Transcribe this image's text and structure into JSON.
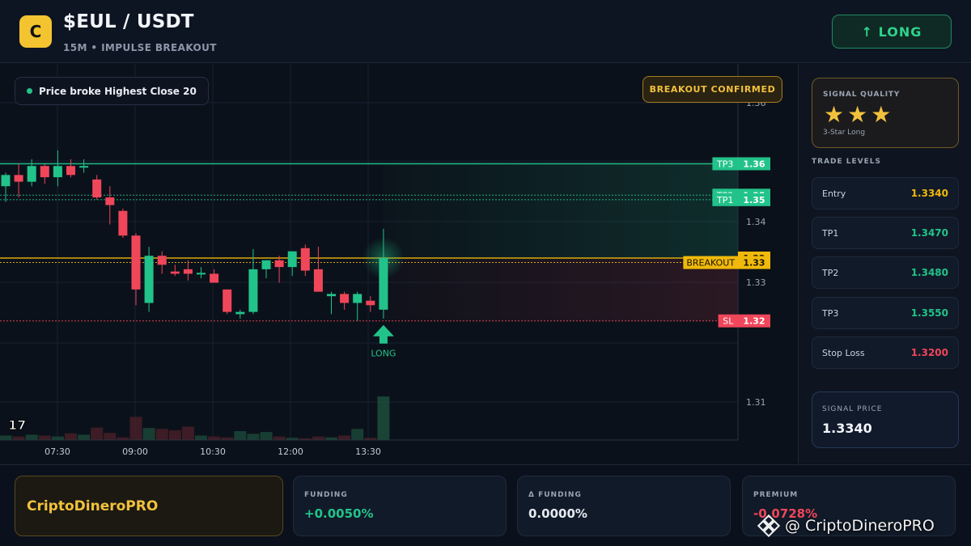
{
  "header": {
    "logo_letter": "C",
    "pair": "$EUL / USDT",
    "subtitle": "15M • IMPULSE BREAKOUT",
    "direction_button": "↑ LONG"
  },
  "chart": {
    "info_pill": "Price broke Highest Close 20",
    "badge": "BREAKOUT CONFIRMED",
    "tv_logo": "17",
    "signal_marker_label": "LONG",
    "price_axis": [
      "1.36",
      "1.35",
      "1.34",
      "1.33",
      "1.31"
    ],
    "time_axis": [
      "07:30",
      "09:00",
      "10:30",
      "12:00",
      "13:30"
    ],
    "levels": [
      {
        "name": "TP3",
        "price": "1.36",
        "value": 1.355,
        "color": "#22c38a"
      },
      {
        "name": "TP2",
        "price": "1.35",
        "value": 1.348,
        "color": "#22c38a"
      },
      {
        "name": "TP1",
        "price": "1.35",
        "value": 1.347,
        "color": "#22c38a"
      },
      {
        "name": "",
        "price": "1.33",
        "value": 1.334,
        "color": "#f0b90b"
      },
      {
        "name": "BREAKOUT",
        "price": "1.33",
        "value": 1.333,
        "color": "#f0b90b"
      },
      {
        "name": "SL",
        "price": "1.32",
        "value": 1.32,
        "color": "#f0465a"
      }
    ],
    "colors": {
      "up": "#22c38a",
      "down": "#f0465a",
      "entry": "#f0b90b"
    },
    "candles": [
      [
        1.35,
        1.353,
        1.3465,
        1.3525
      ],
      [
        1.3525,
        1.355,
        1.3475,
        1.351
      ],
      [
        1.351,
        1.356,
        1.35,
        1.3545
      ],
      [
        1.3545,
        1.355,
        1.3505,
        1.352
      ],
      [
        1.352,
        1.358,
        1.35,
        1.3545
      ],
      [
        1.3545,
        1.356,
        1.352,
        1.3525
      ],
      [
        1.3545,
        1.356,
        1.353,
        1.3545
      ],
      [
        1.3515,
        1.3525,
        1.347,
        1.3475
      ],
      [
        1.3475,
        1.35,
        1.3415,
        1.3458
      ],
      [
        1.3445,
        1.345,
        1.3385,
        1.339
      ],
      [
        1.339,
        1.3395,
        1.3235,
        1.327
      ],
      [
        1.324,
        1.3365,
        1.322,
        1.3345
      ],
      [
        1.3345,
        1.3355,
        1.3305,
        1.3325
      ],
      [
        1.331,
        1.3325,
        1.33,
        1.3305
      ],
      [
        1.3315,
        1.3335,
        1.329,
        1.3305
      ],
      [
        1.3305,
        1.332,
        1.3295,
        1.3307
      ],
      [
        1.3305,
        1.3315,
        1.3285,
        1.3285
      ],
      [
        1.327,
        1.327,
        1.3215,
        1.322
      ],
      [
        1.3215,
        1.3225,
        1.3205,
        1.322
      ],
      [
        1.322,
        1.336,
        1.3215,
        1.3315
      ],
      [
        1.3315,
        1.3335,
        1.3295,
        1.3335
      ],
      [
        1.3335,
        1.3345,
        1.3285,
        1.332
      ],
      [
        1.332,
        1.3355,
        1.33,
        1.3355
      ],
      [
        1.3362,
        1.337,
        1.33,
        1.3312
      ],
      [
        1.3315,
        1.3365,
        1.3275,
        1.3265
      ],
      [
        1.3255,
        1.3265,
        1.3215,
        1.326
      ],
      [
        1.326,
        1.3265,
        1.3225,
        1.324
      ],
      [
        1.324,
        1.3265,
        1.32,
        1.326
      ],
      [
        1.3245,
        1.3255,
        1.322,
        1.3235
      ],
      [
        1.3225,
        1.3405,
        1.3205,
        1.334
      ]
    ],
    "volumes": [
      0.1,
      0.08,
      0.12,
      0.1,
      0.08,
      0.15,
      0.12,
      0.28,
      0.16,
      0.06,
      0.52,
      0.27,
      0.25,
      0.22,
      0.3,
      0.1,
      0.08,
      0.06,
      0.2,
      0.14,
      0.18,
      0.08,
      0.05,
      0.04,
      0.08,
      0.06,
      0.1,
      0.25,
      0.05,
      0.98
    ]
  },
  "sidebar": {
    "signal_quality_title": "SIGNAL QUALITY",
    "stars": "★★★",
    "star_count": 3,
    "quality_sub": "3-Star Long",
    "trade_levels_title": "TRADE LEVELS",
    "trade_levels": [
      {
        "label": "Entry",
        "value": "1.3340",
        "color": "#f0b90b"
      },
      {
        "label": "TP1",
        "value": "1.3470",
        "color": "#22c38a"
      },
      {
        "label": "TP2",
        "value": "1.3480",
        "color": "#22c38a"
      },
      {
        "label": "TP3",
        "value": "1.3550",
        "color": "#22c38a"
      },
      {
        "label": "Stop Loss",
        "value": "1.3200",
        "color": "#f0465a"
      }
    ],
    "signal_price_title": "SIGNAL PRICE",
    "signal_price": "1.3340"
  },
  "footer": {
    "brand": "CriptoDineroPRO",
    "stats": [
      {
        "title": "FUNDING",
        "value": "+0.0050%",
        "color": "#22c38a"
      },
      {
        "title": "Δ FUNDING",
        "value": "0.0000%",
        "color": "#e6ebf2"
      },
      {
        "title": "PREMIUM",
        "value": "-0.0728%",
        "color": "#f0465a"
      }
    ],
    "watermark": "@ CriptoDineroPRO"
  }
}
